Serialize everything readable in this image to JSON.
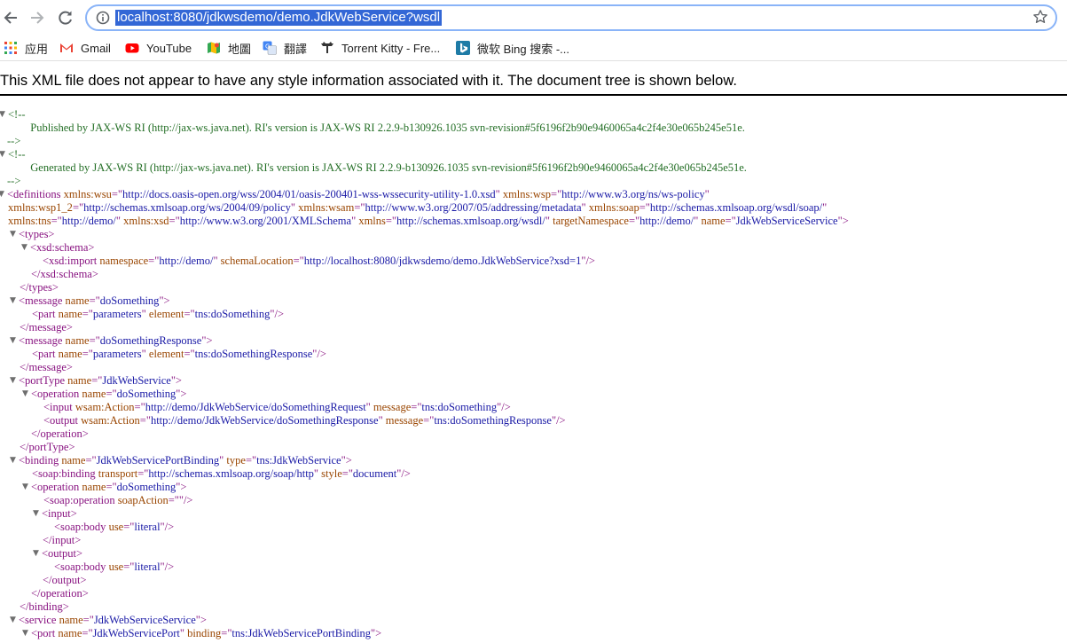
{
  "browser": {
    "url": "localhost:8080/jdkwsdemo/demo.JdkWebService?wsdl",
    "bookmarks": [
      {
        "label": "应用",
        "icon": "apps-grid-icon"
      },
      {
        "label": "Gmail",
        "icon": "gmail-icon"
      },
      {
        "label": "YouTube",
        "icon": "youtube-icon"
      },
      {
        "label": "地圖",
        "icon": "maps-icon"
      },
      {
        "label": "翻譯",
        "icon": "translate-icon"
      },
      {
        "label": "Torrent Kitty - Fre...",
        "icon": "torrent-kitty-icon"
      },
      {
        "label": "微软 Bing 搜索 -...",
        "icon": "bing-icon"
      }
    ]
  },
  "notice": "This XML file does not appear to have any style information associated with it. The document tree is shown below.",
  "xml": {
    "comment1": "Published by JAX-WS RI (http://jax-ws.java.net). RI's version is JAX-WS RI 2.2.9-b130926.1035 svn-revision#5f6196f2b90e9460065a4c2f4e30e065b245e51e.",
    "comment2": "Generated by JAX-WS RI (http://jax-ws.java.net). RI's version is JAX-WS RI 2.2.9-b130926.1035 svn-revision#5f6196f2b90e9460065a4c2f4e30e065b245e51e.",
    "lines": [
      [
        [
          "cm",
          "<!--"
        ]
      ],
      [
        [
          "cm",
          "  Published by JAX-WS RI (http://jax-ws.java.net). RI's version is JAX-WS RI 2.2.9-b130926.1035 svn-revision#5f6196f2b90e9460065a4c2f4e30e065b245e51e."
        ]
      ],
      [
        [
          "cm",
          "-->"
        ]
      ],
      [
        [
          "cm",
          "<!--"
        ]
      ],
      [
        [
          "cm",
          "  Generated by JAX-WS RI (http://jax-ws.java.net). RI's version is JAX-WS RI 2.2.9-b130926.1035 svn-revision#5f6196f2b90e9460065a4c2f4e30e065b245e51e."
        ]
      ],
      [
        [
          "cm",
          "-->"
        ]
      ],
      [
        [
          "tg",
          "<definitions "
        ],
        [
          "an",
          "xmlns:wsu"
        ],
        [
          "tg",
          "=\""
        ],
        [
          "av",
          "http://docs.oasis-open.org/wss/2004/01/oasis-200401-wss-wssecurity-utility-1.0.xsd"
        ],
        [
          "tg",
          "\" "
        ],
        [
          "an",
          "xmlns:wsp"
        ],
        [
          "tg",
          "=\""
        ],
        [
          "av",
          "http://www.w3.org/ns/ws-policy"
        ],
        [
          "tg",
          "\""
        ]
      ],
      [
        [
          "an",
          "xmlns:wsp1_2"
        ],
        [
          "tg",
          "=\""
        ],
        [
          "av",
          "http://schemas.xmlsoap.org/ws/2004/09/policy"
        ],
        [
          "tg",
          "\" "
        ],
        [
          "an",
          "xmlns:wsam"
        ],
        [
          "tg",
          "=\""
        ],
        [
          "av",
          "http://www.w3.org/2007/05/addressing/metadata"
        ],
        [
          "tg",
          "\" "
        ],
        [
          "an",
          "xmlns:soap"
        ],
        [
          "tg",
          "=\""
        ],
        [
          "av",
          "http://schemas.xmlsoap.org/wsdl/soap/"
        ],
        [
          "tg",
          "\""
        ]
      ],
      [
        [
          "an",
          "xmlns:tns"
        ],
        [
          "tg",
          "=\""
        ],
        [
          "av",
          "http://demo/"
        ],
        [
          "tg",
          "\" "
        ],
        [
          "an",
          "xmlns:xsd"
        ],
        [
          "tg",
          "=\""
        ],
        [
          "av",
          "http://www.w3.org/2001/XMLSchema"
        ],
        [
          "tg",
          "\" "
        ],
        [
          "an",
          "xmlns"
        ],
        [
          "tg",
          "=\""
        ],
        [
          "av",
          "http://schemas.xmlsoap.org/wsdl/"
        ],
        [
          "tg",
          "\" "
        ],
        [
          "an",
          "targetNamespace"
        ],
        [
          "tg",
          "=\""
        ],
        [
          "av",
          "http://demo/"
        ],
        [
          "tg",
          "\" "
        ],
        [
          "an",
          "name"
        ],
        [
          "tg",
          "=\""
        ],
        [
          "av",
          "JdkWebServiceService"
        ],
        [
          "tg",
          "\">"
        ]
      ],
      [
        [
          "tg",
          "<types>"
        ]
      ],
      [
        [
          "tg",
          "<xsd:schema>"
        ]
      ],
      [
        [
          "tg",
          "<xsd:import "
        ],
        [
          "an",
          "namespace"
        ],
        [
          "tg",
          "=\""
        ],
        [
          "av",
          "http://demo/"
        ],
        [
          "tg",
          "\" "
        ],
        [
          "an",
          "schemaLocation"
        ],
        [
          "tg",
          "=\""
        ],
        [
          "av",
          "http://localhost:8080/jdkwsdemo/demo.JdkWebService?xsd=1"
        ],
        [
          "tg",
          "\"/>"
        ]
      ],
      [
        [
          "tg",
          "</xsd:schema>"
        ]
      ],
      [
        [
          "tg",
          "</types>"
        ]
      ],
      [
        [
          "tg",
          "<message "
        ],
        [
          "an",
          "name"
        ],
        [
          "tg",
          "=\""
        ],
        [
          "av",
          "doSomething"
        ],
        [
          "tg",
          "\">"
        ]
      ],
      [
        [
          "tg",
          "<part "
        ],
        [
          "an",
          "name"
        ],
        [
          "tg",
          "=\""
        ],
        [
          "av",
          "parameters"
        ],
        [
          "tg",
          "\" "
        ],
        [
          "an",
          "element"
        ],
        [
          "tg",
          "=\""
        ],
        [
          "av",
          "tns:doSomething"
        ],
        [
          "tg",
          "\"/>"
        ]
      ],
      [
        [
          "tg",
          "</message>"
        ]
      ],
      [
        [
          "tg",
          "<message "
        ],
        [
          "an",
          "name"
        ],
        [
          "tg",
          "=\""
        ],
        [
          "av",
          "doSomethingResponse"
        ],
        [
          "tg",
          "\">"
        ]
      ],
      [
        [
          "tg",
          "<part "
        ],
        [
          "an",
          "name"
        ],
        [
          "tg",
          "=\""
        ],
        [
          "av",
          "parameters"
        ],
        [
          "tg",
          "\" "
        ],
        [
          "an",
          "element"
        ],
        [
          "tg",
          "=\""
        ],
        [
          "av",
          "tns:doSomethingResponse"
        ],
        [
          "tg",
          "\"/>"
        ]
      ],
      [
        [
          "tg",
          "</message>"
        ]
      ],
      [
        [
          "tg",
          "<portType "
        ],
        [
          "an",
          "name"
        ],
        [
          "tg",
          "=\""
        ],
        [
          "av",
          "JdkWebService"
        ],
        [
          "tg",
          "\">"
        ]
      ],
      [
        [
          "tg",
          "<operation "
        ],
        [
          "an",
          "name"
        ],
        [
          "tg",
          "=\""
        ],
        [
          "av",
          "doSomething"
        ],
        [
          "tg",
          "\">"
        ]
      ],
      [
        [
          "tg",
          "<input "
        ],
        [
          "an",
          "wsam:Action"
        ],
        [
          "tg",
          "=\""
        ],
        [
          "av",
          "http://demo/JdkWebService/doSomethingRequest"
        ],
        [
          "tg",
          "\" "
        ],
        [
          "an",
          "message"
        ],
        [
          "tg",
          "=\""
        ],
        [
          "av",
          "tns:doSomething"
        ],
        [
          "tg",
          "\"/>"
        ]
      ],
      [
        [
          "tg",
          "<output "
        ],
        [
          "an",
          "wsam:Action"
        ],
        [
          "tg",
          "=\""
        ],
        [
          "av",
          "http://demo/JdkWebService/doSomethingResponse"
        ],
        [
          "tg",
          "\" "
        ],
        [
          "an",
          "message"
        ],
        [
          "tg",
          "=\""
        ],
        [
          "av",
          "tns:doSomethingResponse"
        ],
        [
          "tg",
          "\"/>"
        ]
      ],
      [
        [
          "tg",
          "</operation>"
        ]
      ],
      [
        [
          "tg",
          "</portType>"
        ]
      ],
      [
        [
          "tg",
          "<binding "
        ],
        [
          "an",
          "name"
        ],
        [
          "tg",
          "=\""
        ],
        [
          "av",
          "JdkWebServicePortBinding"
        ],
        [
          "tg",
          "\" "
        ],
        [
          "an",
          "type"
        ],
        [
          "tg",
          "=\""
        ],
        [
          "av",
          "tns:JdkWebService"
        ],
        [
          "tg",
          "\">"
        ]
      ],
      [
        [
          "tg",
          "<soap:binding "
        ],
        [
          "an",
          "transport"
        ],
        [
          "tg",
          "=\""
        ],
        [
          "av",
          "http://schemas.xmlsoap.org/soap/http"
        ],
        [
          "tg",
          "\" "
        ],
        [
          "an",
          "style"
        ],
        [
          "tg",
          "=\""
        ],
        [
          "av",
          "document"
        ],
        [
          "tg",
          "\"/>"
        ]
      ],
      [
        [
          "tg",
          "<operation "
        ],
        [
          "an",
          "name"
        ],
        [
          "tg",
          "=\""
        ],
        [
          "av",
          "doSomething"
        ],
        [
          "tg",
          "\">"
        ]
      ],
      [
        [
          "tg",
          "<soap:operation "
        ],
        [
          "an",
          "soapAction"
        ],
        [
          "tg",
          "=\""
        ],
        [
          "av",
          ""
        ],
        [
          "tg",
          "\"/>"
        ]
      ],
      [
        [
          "tg",
          "<input>"
        ]
      ],
      [
        [
          "tg",
          "<soap:body "
        ],
        [
          "an",
          "use"
        ],
        [
          "tg",
          "=\""
        ],
        [
          "av",
          "literal"
        ],
        [
          "tg",
          "\"/>"
        ]
      ],
      [
        [
          "tg",
          "</input>"
        ]
      ],
      [
        [
          "tg",
          "<output>"
        ]
      ],
      [
        [
          "tg",
          "<soap:body "
        ],
        [
          "an",
          "use"
        ],
        [
          "tg",
          "=\""
        ],
        [
          "av",
          "literal"
        ],
        [
          "tg",
          "\"/>"
        ]
      ],
      [
        [
          "tg",
          "</output>"
        ]
      ],
      [
        [
          "tg",
          "</operation>"
        ]
      ],
      [
        [
          "tg",
          "</binding>"
        ]
      ],
      [
        [
          "tg",
          "<service "
        ],
        [
          "an",
          "name"
        ],
        [
          "tg",
          "=\""
        ],
        [
          "av",
          "JdkWebServiceService"
        ],
        [
          "tg",
          "\">"
        ]
      ],
      [
        [
          "tg",
          "<port "
        ],
        [
          "an",
          "name"
        ],
        [
          "tg",
          "=\""
        ],
        [
          "av",
          "JdkWebServicePort"
        ],
        [
          "tg",
          "\" "
        ],
        [
          "an",
          "binding"
        ],
        [
          "tg",
          "=\""
        ],
        [
          "av",
          "tns:JdkWebServicePortBinding"
        ],
        [
          "tg",
          "\">"
        ]
      ]
    ]
  }
}
